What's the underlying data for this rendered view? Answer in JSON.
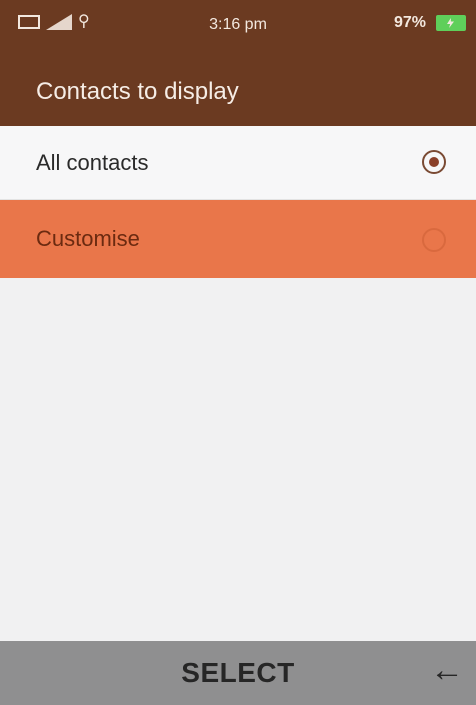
{
  "status_bar": {
    "time": "3:16 pm",
    "battery_percent": "97%",
    "icons": [
      "signal-icon",
      "wifi-icon",
      "location-icon",
      "battery-charging-icon"
    ]
  },
  "header": {
    "title": "Contacts to display"
  },
  "options": [
    {
      "label": "All contacts",
      "selected": true
    },
    {
      "label": "Customise",
      "selected": false
    }
  ],
  "softkeys": {
    "center_label": "SELECT",
    "right_icon": "back-arrow-icon"
  },
  "colors": {
    "header_bg": "#6b3a21",
    "highlight": "#e9764a",
    "softkey_bg": "#8f8f90",
    "background": "#f1f1f2"
  }
}
